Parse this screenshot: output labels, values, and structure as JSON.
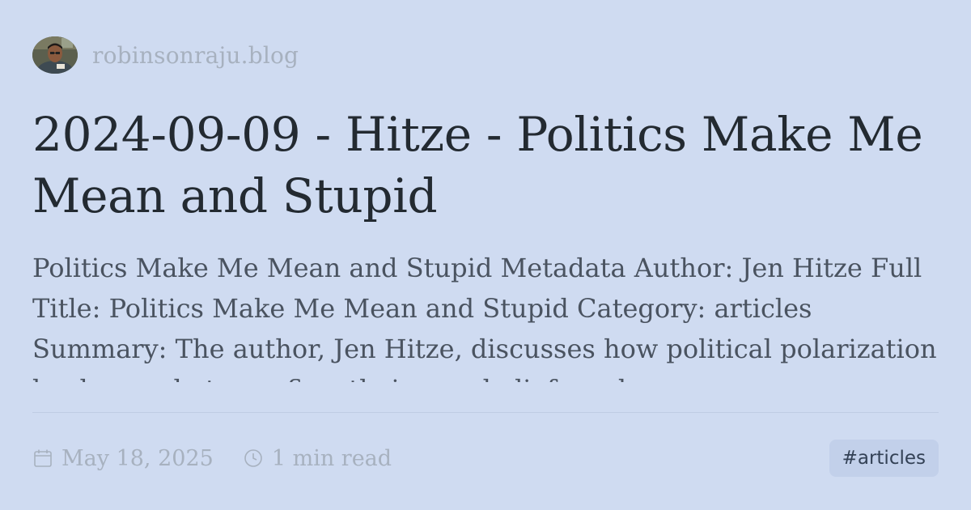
{
  "site": {
    "name": "robinsonraju.blog"
  },
  "post": {
    "title": "2024-09-09 - Hitze - Politics Make Me Mean and Stupid",
    "excerpt": "Politics Make Me Mean and Stupid Metadata Author: Jen Hitze Full Title: Politics Make Me Mean and Stupid Category: articles Summary: The author, Jen Hitze, discusses how political polarization leads people to confirm their own beliefs and"
  },
  "meta": {
    "date": "May 18, 2025",
    "date_icon": "calendar-icon",
    "read_time": "1 min read",
    "read_time_icon": "clock-icon",
    "tag": "#articles"
  },
  "colors": {
    "background": "#cfdbf1",
    "title_text": "#232a31",
    "muted_text": "#a7b1bf",
    "tag_background": "#c2d0ea"
  }
}
